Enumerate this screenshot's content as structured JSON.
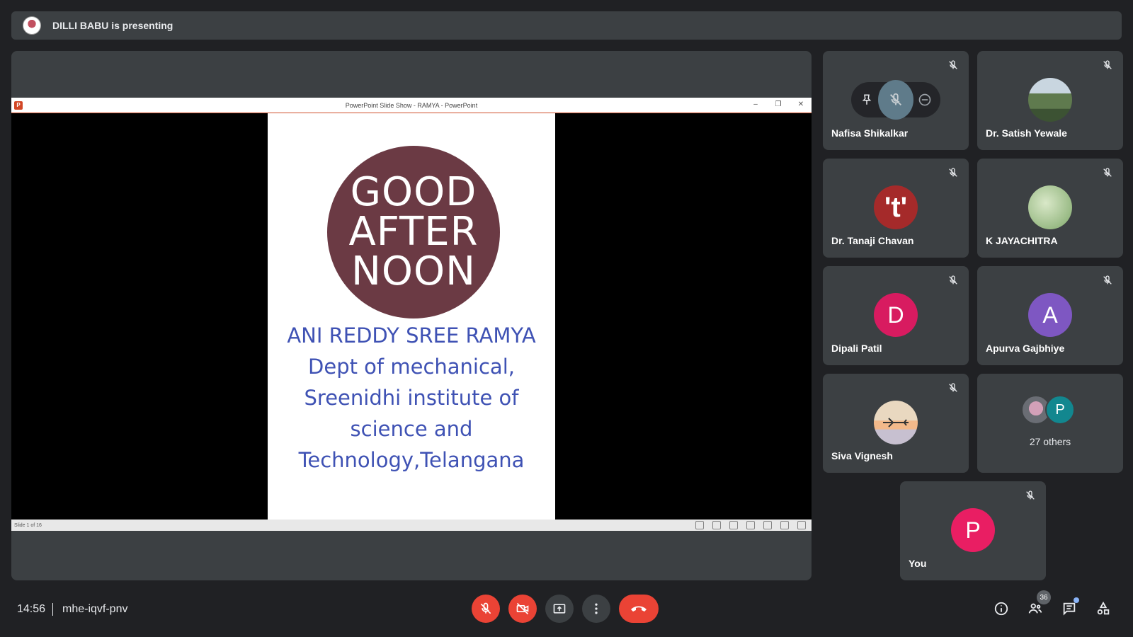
{
  "presenting_bar": {
    "text": "DILLI BABU is presenting"
  },
  "stage": {
    "window_title": "PowerPoint Slide Show  -  RAMYA - PowerPoint",
    "slide": {
      "circle_lines": [
        "GOOD",
        "AFTER",
        "NOON"
      ],
      "name": "ANI REDDY SREE RAMYA",
      "lines": [
        "Dept of mechanical,",
        "Sreenidhi institute of",
        "science and",
        "Technology,Telangana"
      ]
    },
    "status": "Slide 1 of 16"
  },
  "participants": [
    {
      "name": "Nafisa Shikalkar",
      "muted": true,
      "hovered": true
    },
    {
      "name": "Dr. Satish Yewale",
      "muted": true,
      "avatar": "photo-valley"
    },
    {
      "name": "Dr. Tanaji Chavan",
      "muted": true,
      "initial": "'t'",
      "color": "#a52a2a"
    },
    {
      "name": "K JAYACHITRA",
      "muted": true,
      "avatar": "photo-text"
    },
    {
      "name": "Dipali Patil",
      "muted": true,
      "initial": "D",
      "color": "#d81b60"
    },
    {
      "name": "Apurva Gajbhiye",
      "muted": true,
      "initial": "A",
      "color": "#7e57c2"
    },
    {
      "name": "Siva Vignesh",
      "muted": true,
      "avatar": "photo-plane"
    }
  ],
  "others_tile": {
    "label": "27 others",
    "initial": "P",
    "color": "#12878f"
  },
  "self_tile": {
    "name": "You",
    "initial": "P",
    "color": "#e91e63"
  },
  "bottom": {
    "time": "14:56",
    "code": "mhe-iqvf-pnv",
    "people_count": "36",
    "icons": [
      "mic-off-icon",
      "camera-off-icon",
      "present-icon",
      "more-options-icon",
      "end-call-icon",
      "info-icon",
      "people-icon",
      "chat-icon",
      "activities-icon"
    ]
  },
  "colors": {
    "background": "#202124",
    "tile": "#3c4043",
    "red": "#ea4335",
    "slide_text": "#3f52b4",
    "circle": "#6b3a44"
  }
}
